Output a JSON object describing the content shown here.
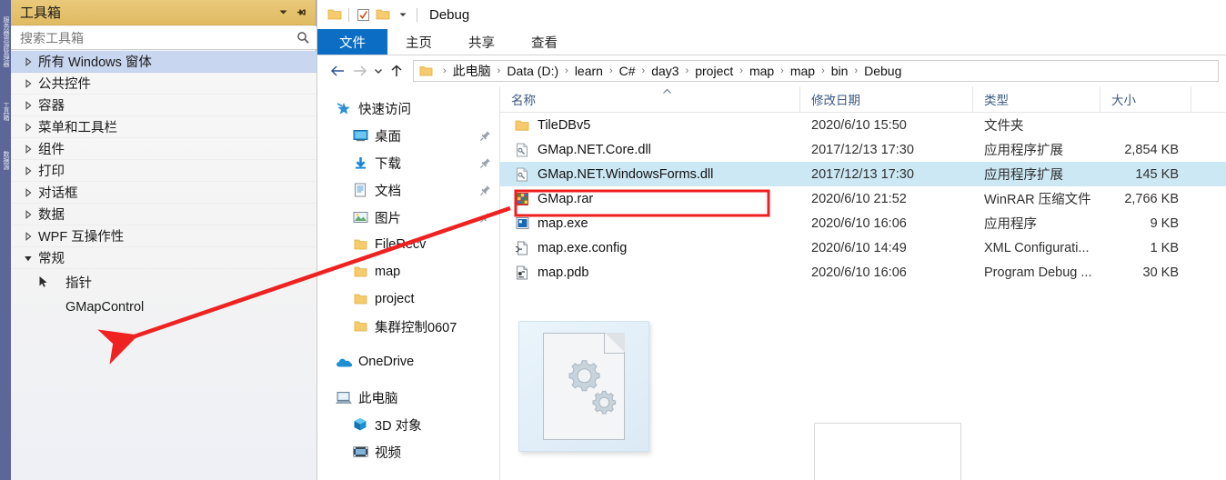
{
  "vs_dock": {
    "tabs": [
      "服务器资源管理器",
      "工具箱",
      "数据源"
    ]
  },
  "toolbox": {
    "title": "工具箱",
    "dropdown_icon": "chevron-down-icon",
    "pin_icon": "pin-icon",
    "search_placeholder": "搜索工具箱",
    "search_icon": "search-icon",
    "nodes": [
      {
        "label": "所有 Windows 窗体",
        "expanded": false,
        "selected": true
      },
      {
        "label": "公共控件",
        "expanded": false,
        "selected": false
      },
      {
        "label": "容器",
        "expanded": false,
        "selected": false
      },
      {
        "label": "菜单和工具栏",
        "expanded": false,
        "selected": false
      },
      {
        "label": "组件",
        "expanded": false,
        "selected": false
      },
      {
        "label": "打印",
        "expanded": false,
        "selected": false
      },
      {
        "label": "对话框",
        "expanded": false,
        "selected": false
      },
      {
        "label": "数据",
        "expanded": false,
        "selected": false
      },
      {
        "label": "WPF 互操作性",
        "expanded": false,
        "selected": false
      },
      {
        "label": "常规",
        "expanded": true,
        "selected": false
      }
    ],
    "items": [
      {
        "label": "指针",
        "icon": "pointer-icon"
      },
      {
        "label": "GMapControl",
        "icon": "none"
      }
    ]
  },
  "explorer": {
    "window_title": "Debug",
    "quick_access": [
      "folder-icon",
      "properties-checked-icon",
      "new-folder-icon",
      "chevron-down-icon"
    ],
    "ribbon_tabs": [
      {
        "label": "文件",
        "active": true
      },
      {
        "label": "主页",
        "active": false
      },
      {
        "label": "共享",
        "active": false
      },
      {
        "label": "查看",
        "active": false
      }
    ],
    "nav_buttons": {
      "back": "arrow-left-icon",
      "forward": "arrow-right-icon",
      "recent": "chevron-down-icon",
      "up": "arrow-up-icon"
    },
    "breadcrumb": [
      "此电脑",
      "Data (D:)",
      "learn",
      "C#",
      "day3",
      "project",
      "map",
      "map",
      "bin",
      "Debug"
    ],
    "nav_pane": [
      {
        "label": "快速访问",
        "icon": "star-icon",
        "indent": 0,
        "pin": false
      },
      {
        "label": "桌面",
        "icon": "desktop-icon",
        "indent": 1,
        "pin": true
      },
      {
        "label": "下载",
        "icon": "download-icon",
        "indent": 1,
        "pin": true
      },
      {
        "label": "文档",
        "icon": "documents-icon",
        "indent": 1,
        "pin": true
      },
      {
        "label": "图片",
        "icon": "pictures-icon",
        "indent": 1,
        "pin": true
      },
      {
        "label": "FileRecv",
        "icon": "folder-icon",
        "indent": 1,
        "pin": false
      },
      {
        "label": "map",
        "icon": "folder-icon",
        "indent": 1,
        "pin": false
      },
      {
        "label": "project",
        "icon": "folder-icon",
        "indent": 1,
        "pin": false
      },
      {
        "label": "集群控制0607",
        "icon": "folder-icon",
        "indent": 1,
        "pin": false
      },
      {
        "label": "OneDrive",
        "icon": "onedrive-icon",
        "indent": 0,
        "pin": false
      },
      {
        "label": "此电脑",
        "icon": "thispc-icon",
        "indent": 0,
        "pin": false
      },
      {
        "label": "3D 对象",
        "icon": "3dobjects-icon",
        "indent": 1,
        "pin": false
      },
      {
        "label": "视频",
        "icon": "videos-icon",
        "indent": 1,
        "pin": false
      }
    ],
    "columns": [
      "名称",
      "修改日期",
      "类型",
      "大小"
    ],
    "sort_indicator": "caret-up-icon",
    "files": [
      {
        "name": "TileDBv5",
        "date": "2020/6/10 15:50",
        "type": "文件夹",
        "size": "",
        "icon": "folder-icon",
        "selected": false,
        "highlighted": false
      },
      {
        "name": "GMap.NET.Core.dll",
        "date": "2017/12/13 17:30",
        "type": "应用程序扩展",
        "size": "2,854 KB",
        "icon": "dll-icon",
        "selected": false,
        "highlighted": false
      },
      {
        "name": "GMap.NET.WindowsForms.dll",
        "date": "2017/12/13 17:30",
        "type": "应用程序扩展",
        "size": "145 KB",
        "icon": "dll-icon",
        "selected": true,
        "highlighted": true
      },
      {
        "name": "GMap.rar",
        "date": "2020/6/10 21:52",
        "type": "WinRAR 压缩文件",
        "size": "2,766 KB",
        "icon": "rar-icon",
        "selected": false,
        "highlighted": false
      },
      {
        "name": "map.exe",
        "date": "2020/6/10 16:06",
        "type": "应用程序",
        "size": "9 KB",
        "icon": "exe-icon",
        "selected": false,
        "highlighted": false
      },
      {
        "name": "map.exe.config",
        "date": "2020/6/10 14:49",
        "type": "XML Configurati...",
        "size": "1 KB",
        "icon": "config-icon",
        "selected": false,
        "highlighted": false
      },
      {
        "name": "map.pdb",
        "date": "2020/6/10 16:06",
        "type": "Program Debug ...",
        "size": "30 KB",
        "icon": "pdb-icon",
        "selected": false,
        "highlighted": false
      }
    ],
    "preview": {
      "icon": "dll-gears-document-icon"
    }
  },
  "annotations": {
    "highlight_box_color": "#f01f1f",
    "arrow_color": "#ef2222",
    "arrow_from": "GMap.NET.WindowsForms.dll row",
    "arrow_to": "GMapControl toolbox item"
  }
}
